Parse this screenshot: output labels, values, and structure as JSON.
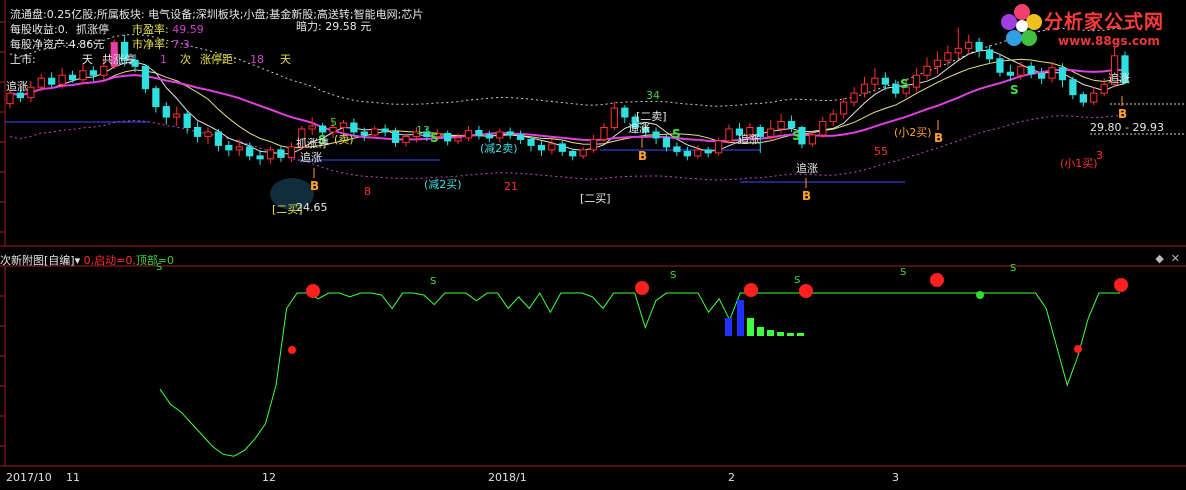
{
  "header": {
    "line1": "流通盘:0.25亿股;所属板块: 电气设备;深圳板块;小盘;基金新股;高送转;智能电网;芯片",
    "eps": "每股收益:0.",
    "nav": "每股净资产:4.86元",
    "listing": "上市:",
    "pe_label": "市盈率:",
    "pe_value": "49.59",
    "pb_label": "市净率:",
    "pb_value": "7.3",
    "hu_value": "1",
    "ci": "次",
    "limit_dist_label": "涨停距:",
    "limit_dist_value": "18",
    "tian": "天",
    "tian2": "天",
    "gongzhangting": "共涨停",
    "zhuazhangting": "抓涨停",
    "anli": "暗力:",
    "anli_value": "29.58",
    "yuan": "元"
  },
  "logo": {
    "title": "分析家公式网",
    "url": "www.88gs.com"
  },
  "subchart": {
    "title": "次新附图[自编]",
    "qidong": "0,启动=0,",
    "dingbu": "顶部=0"
  },
  "x_labels": [
    "2017/10",
    "11",
    "12",
    "2018/1",
    "2",
    "3"
  ],
  "colors": {
    "bg": "#000000",
    "up": "#ff3030",
    "down": "#30e0e0",
    "ma_mag": "#e040e0",
    "ma_yel": "#e8e080",
    "ma_wht": "#e0e0e0",
    "band": "#d0d0d0",
    "line_green": "#40ff40",
    "limit": "#e040b0",
    "blue_line": "#3050ff"
  },
  "chart_data": [
    {
      "type": "candlestick",
      "price_range": [
        19.5,
        34.5
      ],
      "last_price_label": "29.80 - 29.93",
      "low_label": "24.65",
      "candles": [
        [
          28.5,
          29.2,
          28.2,
          29.4
        ],
        [
          29.2,
          28.9,
          28.6,
          29.6
        ],
        [
          28.9,
          29.6,
          28.6,
          30.0
        ],
        [
          29.6,
          30.2,
          29.3,
          30.5
        ],
        [
          30.2,
          29.8,
          29.6,
          30.6
        ],
        [
          29.8,
          30.4,
          29.5,
          30.9
        ],
        [
          30.4,
          30.1,
          29.9,
          30.7
        ],
        [
          30.1,
          30.7,
          29.8,
          31.2
        ],
        [
          30.7,
          30.4,
          30.0,
          31.0
        ],
        [
          30.4,
          31.0,
          30.1,
          31.6
        ],
        [
          31.0,
          32.6,
          30.8,
          32.8
        ],
        [
          32.6,
          31.4,
          31.0,
          33.1
        ],
        [
          31.4,
          31.0,
          30.6,
          31.8
        ],
        [
          31.0,
          29.5,
          29.2,
          31.1
        ],
        [
          29.5,
          28.3,
          27.9,
          29.7
        ],
        [
          28.3,
          27.6,
          27.1,
          28.6
        ],
        [
          27.6,
          27.8,
          27.0,
          28.3
        ],
        [
          27.8,
          26.9,
          26.5,
          28.0
        ],
        [
          26.9,
          26.3,
          25.9,
          27.3
        ],
        [
          26.3,
          26.6,
          25.8,
          26.9
        ],
        [
          26.6,
          25.7,
          25.3,
          26.8
        ],
        [
          25.7,
          25.4,
          25.0,
          26.0
        ],
        [
          25.4,
          25.6,
          25.0,
          26.1
        ],
        [
          25.6,
          25.0,
          24.7,
          25.9
        ],
        [
          25.0,
          24.8,
          24.4,
          25.4
        ],
        [
          24.8,
          25.4,
          24.5,
          25.6
        ],
        [
          25.4,
          24.9,
          24.6,
          25.7
        ],
        [
          24.9,
          25.6,
          24.6,
          25.9
        ],
        [
          25.6,
          26.8,
          25.4,
          27.0
        ],
        [
          26.8,
          27.0,
          26.4,
          27.6
        ],
        [
          27.0,
          26.6,
          26.3,
          27.2
        ],
        [
          26.6,
          26.9,
          26.2,
          27.3
        ],
        [
          26.9,
          27.2,
          26.6,
          27.4
        ],
        [
          27.2,
          26.6,
          26.3,
          27.5
        ],
        [
          26.6,
          26.4,
          26.0,
          26.9
        ],
        [
          26.4,
          26.8,
          26.1,
          27.0
        ],
        [
          26.8,
          26.6,
          26.3,
          27.1
        ],
        [
          26.6,
          25.9,
          25.6,
          26.9
        ],
        [
          25.9,
          26.3,
          25.6,
          26.5
        ],
        [
          26.3,
          26.6,
          25.9,
          26.9
        ],
        [
          26.6,
          26.3,
          26.0,
          26.9
        ],
        [
          26.3,
          26.5,
          26.0,
          26.8
        ],
        [
          26.5,
          26.0,
          25.7,
          26.7
        ],
        [
          26.0,
          26.2,
          25.8,
          26.5
        ],
        [
          26.2,
          26.7,
          26.0,
          27.0
        ],
        [
          26.7,
          26.4,
          26.1,
          27.0
        ],
        [
          26.4,
          26.2,
          25.9,
          26.7
        ],
        [
          26.2,
          26.6,
          25.9,
          26.8
        ],
        [
          26.6,
          26.4,
          26.1,
          26.9
        ],
        [
          26.4,
          26.1,
          25.8,
          26.7
        ],
        [
          26.1,
          25.7,
          25.3,
          26.3
        ],
        [
          25.7,
          25.4,
          25.0,
          26.0
        ],
        [
          25.4,
          25.8,
          25.1,
          26.1
        ],
        [
          25.8,
          25.3,
          25.0,
          26.0
        ],
        [
          25.3,
          25.0,
          24.7,
          25.5
        ],
        [
          25.0,
          25.4,
          24.8,
          25.6
        ],
        [
          25.4,
          26.1,
          25.2,
          26.4
        ],
        [
          26.1,
          26.9,
          25.9,
          27.2
        ],
        [
          26.9,
          28.2,
          26.7,
          28.6
        ],
        [
          28.2,
          27.6,
          27.2,
          28.4
        ],
        [
          27.6,
          26.9,
          26.5,
          27.8
        ],
        [
          26.9,
          26.6,
          26.3,
          27.2
        ],
        [
          26.6,
          26.2,
          25.8,
          26.9
        ],
        [
          26.2,
          25.6,
          25.3,
          26.4
        ],
        [
          25.6,
          25.3,
          25.0,
          25.9
        ],
        [
          25.3,
          25.0,
          24.7,
          25.6
        ],
        [
          25.0,
          25.4,
          24.8,
          25.7
        ],
        [
          25.4,
          25.2,
          24.9,
          25.6
        ],
        [
          25.2,
          26.0,
          25.0,
          26.2
        ],
        [
          26.0,
          26.8,
          25.8,
          27.1
        ],
        [
          26.8,
          26.4,
          26.0,
          27.2
        ],
        [
          26.4,
          26.9,
          26.1,
          27.2
        ],
        [
          26.9,
          26.3,
          25.2,
          27.1
        ],
        [
          26.3,
          26.8,
          26.0,
          27.4
        ],
        [
          26.8,
          27.3,
          26.5,
          27.8
        ],
        [
          27.3,
          26.9,
          26.6,
          27.7
        ],
        [
          26.9,
          25.8,
          25.5,
          27.0
        ],
        [
          25.8,
          26.4,
          25.6,
          26.6
        ],
        [
          26.4,
          27.3,
          26.2,
          27.6
        ],
        [
          27.3,
          27.8,
          27.0,
          28.1
        ],
        [
          27.8,
          28.6,
          27.5,
          28.9
        ],
        [
          28.6,
          29.2,
          28.3,
          29.6
        ],
        [
          29.2,
          29.8,
          28.9,
          30.3
        ],
        [
          29.8,
          30.2,
          29.3,
          30.9
        ],
        [
          30.2,
          29.8,
          29.4,
          30.6
        ],
        [
          29.8,
          29.2,
          28.9,
          30.1
        ],
        [
          29.2,
          29.6,
          28.9,
          30.0
        ],
        [
          29.6,
          30.4,
          29.3,
          30.9
        ],
        [
          30.4,
          31.0,
          30.1,
          31.6
        ],
        [
          31.0,
          31.4,
          30.5,
          32.0
        ],
        [
          31.4,
          31.9,
          31.0,
          32.4
        ],
        [
          31.9,
          32.2,
          31.5,
          33.6
        ],
        [
          32.2,
          32.6,
          31.8,
          33.1
        ],
        [
          32.6,
          32.1,
          31.6,
          32.9
        ],
        [
          32.1,
          31.5,
          31.2,
          32.4
        ],
        [
          31.5,
          30.6,
          30.3,
          31.8
        ],
        [
          30.6,
          30.4,
          30.0,
          31.1
        ],
        [
          30.4,
          31.0,
          30.1,
          31.3
        ],
        [
          31.0,
          30.5,
          30.2,
          31.3
        ],
        [
          30.5,
          30.2,
          29.8,
          30.9
        ],
        [
          30.2,
          30.9,
          29.9,
          31.3
        ],
        [
          30.9,
          30.1,
          29.6,
          31.2
        ],
        [
          30.1,
          29.1,
          28.8,
          30.3
        ],
        [
          29.1,
          28.6,
          28.3,
          29.3
        ],
        [
          28.6,
          29.2,
          28.4,
          29.6
        ],
        [
          29.2,
          29.8,
          29.0,
          30.2
        ],
        [
          29.8,
          31.7,
          29.6,
          32.4
        ],
        [
          31.7,
          29.9,
          29.8,
          32.0
        ]
      ],
      "labels": [
        "追涨",
        "抓涨停",
        "(卖)",
        "追涨",
        "(减2卖)",
        "(减2买)",
        "[二买]",
        "[二卖]",
        "追涨",
        "(小2买)",
        "(小1买)",
        "[二买]"
      ],
      "numbers": [
        "5",
        "8",
        "13",
        "21",
        "34",
        "55",
        "3"
      ]
    },
    {
      "type": "line",
      "range": [
        0,
        100
      ],
      "values": [
        38,
        30,
        26,
        20,
        14,
        8,
        4,
        3,
        6,
        12,
        20,
        40,
        80,
        88,
        88,
        85,
        88,
        88,
        86,
        88,
        88,
        87,
        80,
        88,
        88,
        87,
        82,
        88,
        88,
        88,
        84,
        88,
        88,
        80,
        86,
        80,
        88,
        78,
        88,
        88,
        88,
        86,
        80,
        88,
        88,
        88,
        70,
        84,
        88,
        88,
        88,
        88,
        78,
        85,
        74,
        88,
        88,
        88,
        88,
        88,
        88,
        88,
        88,
        88,
        88,
        88,
        88,
        88,
        88,
        88,
        88,
        88,
        88,
        88,
        88,
        88,
        88,
        88,
        88,
        88,
        88,
        88,
        88,
        88,
        80,
        60,
        40,
        55,
        75,
        88,
        88,
        88
      ],
      "red_circles": 5,
      "s_marks": 6
    }
  ]
}
